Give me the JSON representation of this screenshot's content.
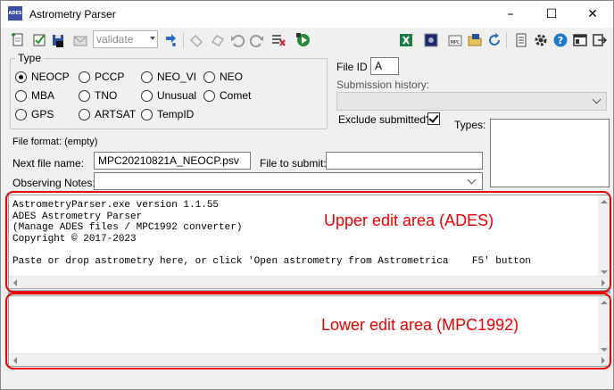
{
  "window": {
    "title": "Astrometry Parser",
    "icon_text": "ADES",
    "minimize_label": "–",
    "maximize_label": "☐",
    "close_label": "✕"
  },
  "toolbar": {
    "validate_combo": "validate"
  },
  "type_group": {
    "label": "Type",
    "options": [
      "NEOCP",
      "PCCP",
      "NEO_VI",
      "NEO",
      "MBA",
      "TNO",
      "Unusual",
      "Comet",
      "GPS",
      "ARTSAT",
      "TempID"
    ],
    "selected": "NEOCP"
  },
  "file_id": {
    "label": "File ID",
    "value": "A"
  },
  "submission_history": {
    "label": "Submission history:"
  },
  "exclude_submitted": {
    "label": "Exclude submitted?",
    "checked": true
  },
  "types": {
    "label": "Types:"
  },
  "file_format": {
    "label": "File format:",
    "value": "(empty)"
  },
  "next_file": {
    "label": "Next file name:",
    "value": "MPC20210821A_NEOCP.psv"
  },
  "file_to_submit": {
    "label": "File to submit:",
    "value": ""
  },
  "observing_notes": {
    "label": "Observing Notes:",
    "value": ""
  },
  "upper_edit": {
    "content": "AstrometryParser.exe version 1.1.55\nADES Astrometry Parser\n(Manage ADES files / MPC1992 converter)\nCopyright © 2017-2023\n\nPaste or drop astrometry here, or click 'Open astrometry from Astrometrica    F5' button",
    "annotation": "Upper edit area (ADES)"
  },
  "lower_edit": {
    "content": "",
    "annotation": "Lower edit area (MPC1992)"
  },
  "colors": {
    "annotation": "#e00000",
    "window_bg": "#f0f0f0",
    "splitter": "#9aa9c9"
  }
}
